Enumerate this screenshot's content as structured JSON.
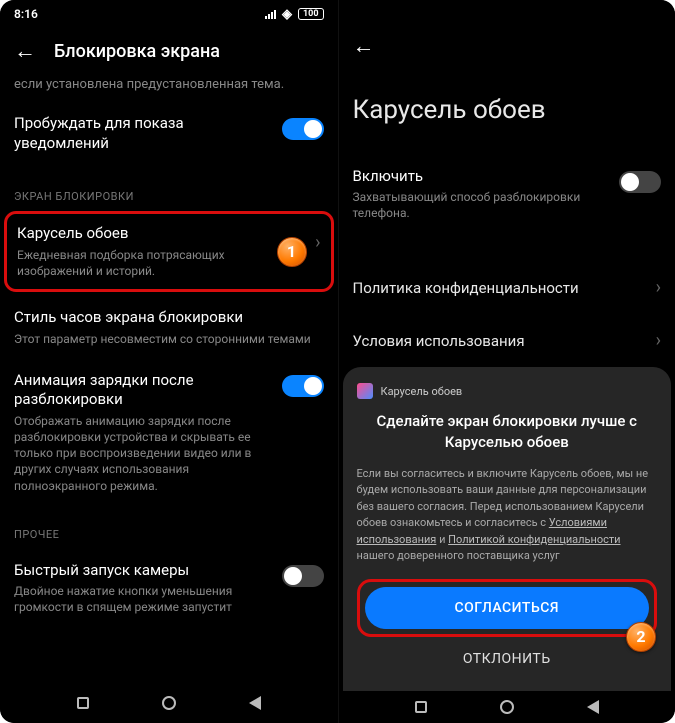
{
  "colors": {
    "highlight": "#d90d0d",
    "accent": "#0a84ff",
    "badge": "#ff7a00"
  },
  "left": {
    "time": "8:16",
    "battery": "100",
    "title": "Блокировка экрана",
    "top_truncated": "если установлена предустановленная тема.",
    "wake": {
      "title": "Пробуждать для показа уведомлений"
    },
    "section1": "ЭКРАН БЛОКИРОВКИ",
    "carousel": {
      "title": "Карусель обоев",
      "subtitle": "Ежедневная подборка потрясающих изображений и историй."
    },
    "clock": {
      "title": "Стиль часов экрана блокировки",
      "subtitle": "Этот параметр несовместим со сторонними темами"
    },
    "charging": {
      "title": "Анимация зарядки после разблокировки",
      "subtitle": "Отображать анимацию зарядки после разблокировки устройства и скрывать ее только при воспроизведении видео или в других случаях использования полноэкранного режима."
    },
    "section2": "ПРОЧЕЕ",
    "camera": {
      "title": "Быстрый запуск камеры",
      "subtitle": "Двойное нажатие кнопки уменьшения громкости в спящем режиме запустит"
    },
    "badge1": "1"
  },
  "right": {
    "title": "Карусель обоев",
    "enable": {
      "title": "Включить",
      "subtitle": "Захватывающий способ разблокировки телефона."
    },
    "privacy": "Политика конфиденциальности",
    "terms": "Условия использования",
    "sheet": {
      "app_name": "Карусель обоев",
      "title": "Сделайте экран блокировки лучше с Каруселью обоев",
      "body_1": "Если вы согласитесь и включите Карусель обоев, мы не будем использовать ваши данные для персонализации без вашего согласия. Перед использованием Карусели обоев ознакомьтесь и согласитесь с ",
      "link_terms": "Условиями использования",
      "body_2": " и ",
      "link_privacy": "Политикой конфиденциальности",
      "body_3": " нашего доверенного поставщика услуг",
      "agree": "СОГЛАСИТЬСЯ",
      "decline": "ОТКЛОНИТЬ"
    },
    "badge2": "2"
  }
}
